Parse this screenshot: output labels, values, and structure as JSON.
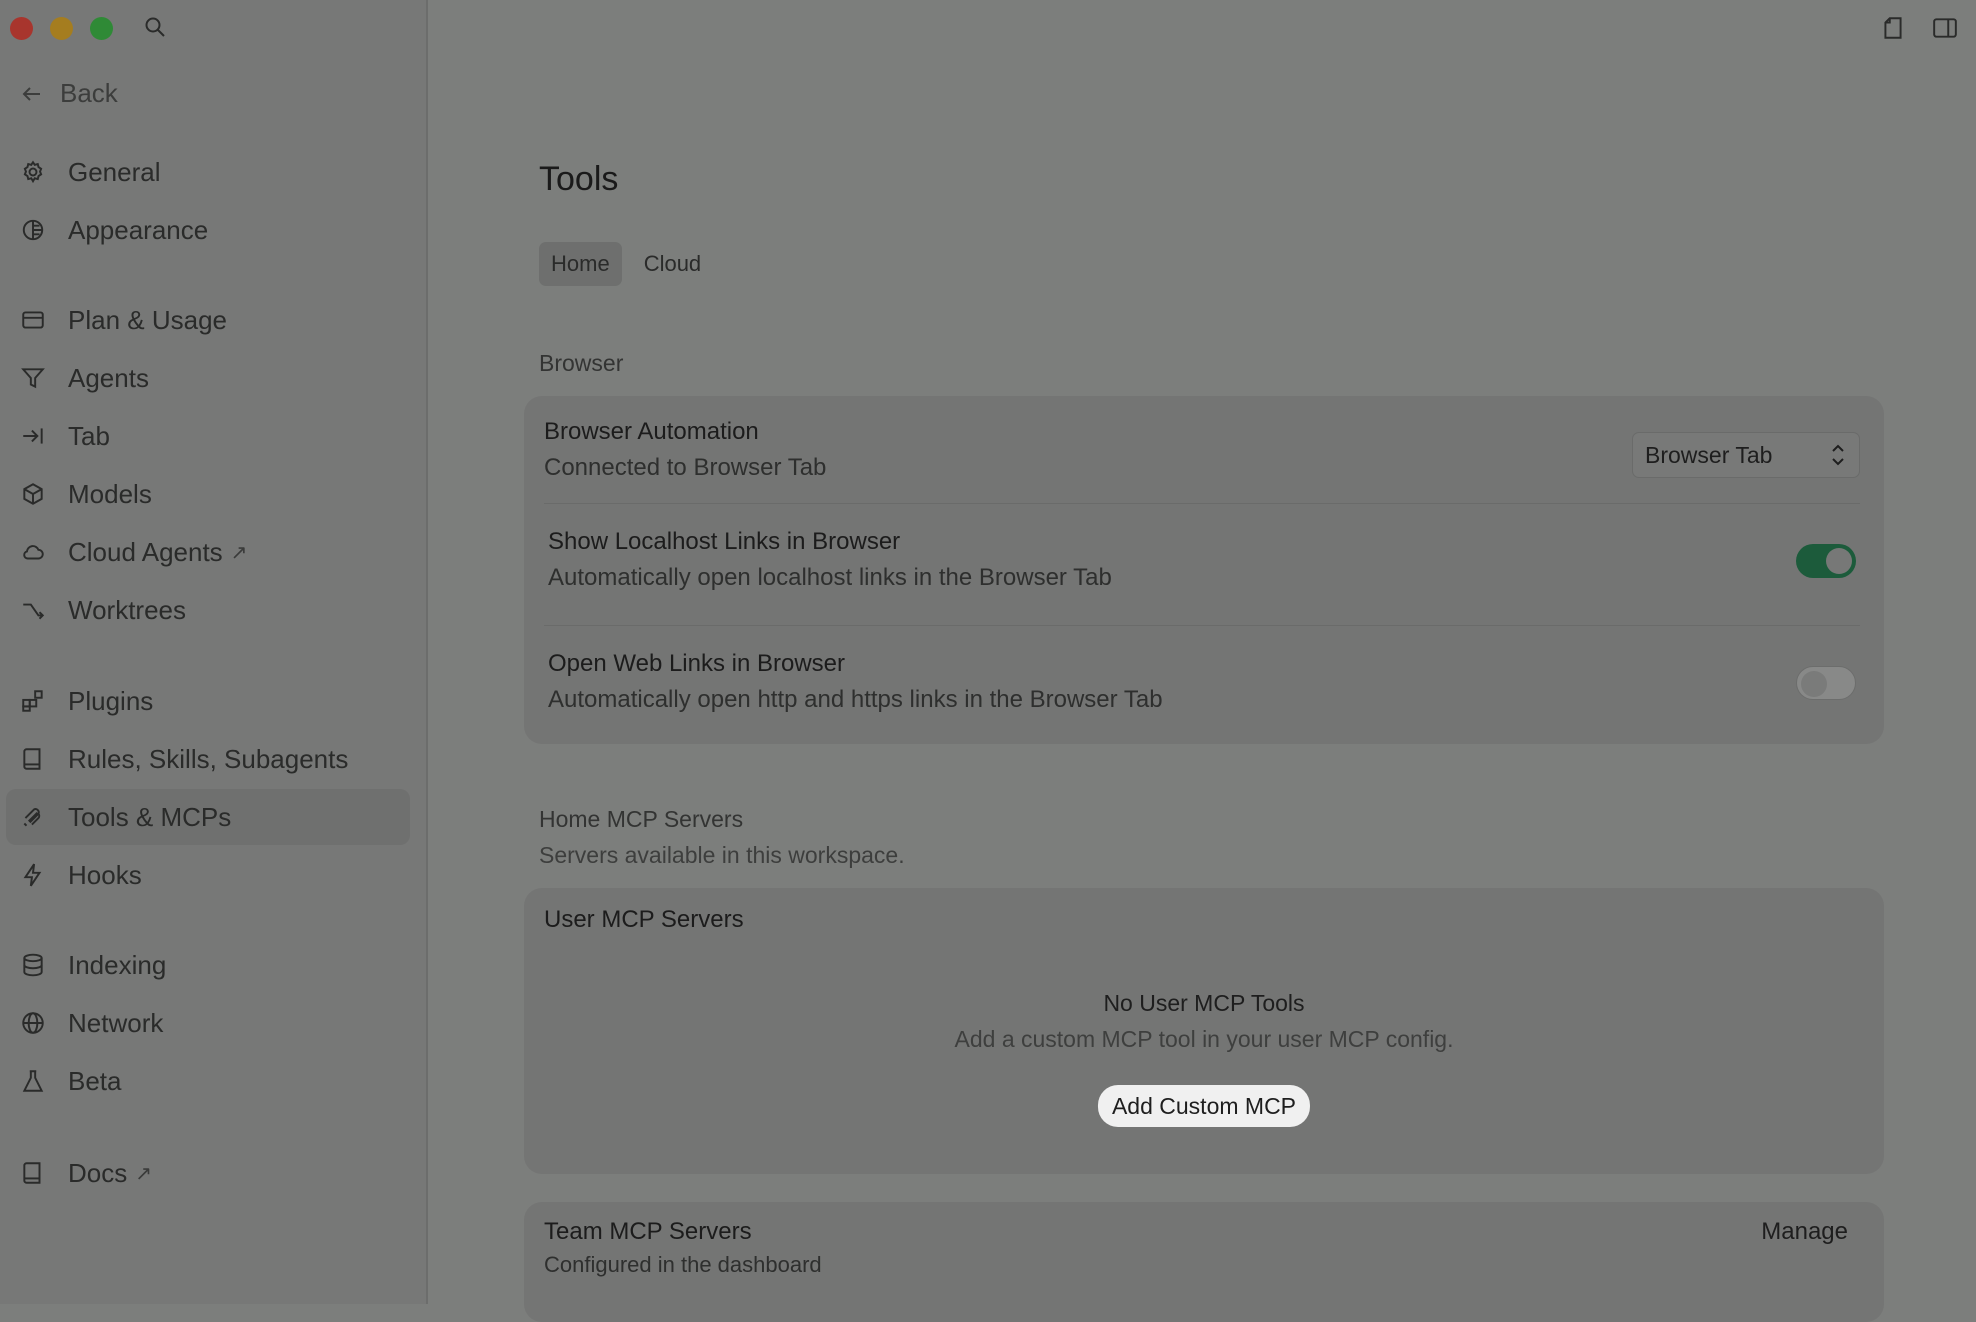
{
  "window": {
    "controls": [
      "close",
      "minimize",
      "zoom"
    ]
  },
  "sidebar": {
    "back_label": "Back",
    "items": [
      {
        "label": "General",
        "icon": "gear-icon"
      },
      {
        "label": "Appearance",
        "icon": "contrast-icon"
      },
      {
        "label": "Plan & Usage",
        "icon": "card-icon"
      },
      {
        "label": "Agents",
        "icon": "funnel-icon"
      },
      {
        "label": "Tab",
        "icon": "tab-arrow-icon"
      },
      {
        "label": "Models",
        "icon": "cube-icon"
      },
      {
        "label": "Cloud Agents",
        "icon": "cloud-icon",
        "external": "↗"
      },
      {
        "label": "Worktrees",
        "icon": "branch-icon"
      },
      {
        "label": "Plugins",
        "icon": "puzzle-icon"
      },
      {
        "label": "Rules, Skills, Subagents",
        "icon": "book-icon"
      },
      {
        "label": "Tools & MCPs",
        "icon": "tools-icon",
        "active": true
      },
      {
        "label": "Hooks",
        "icon": "bolt-icon"
      },
      {
        "label": "Indexing",
        "icon": "database-icon"
      },
      {
        "label": "Network",
        "icon": "globe-icon"
      },
      {
        "label": "Beta",
        "icon": "flask-icon"
      },
      {
        "label": "Docs",
        "icon": "book-icon",
        "external": "↗"
      }
    ]
  },
  "main": {
    "title": "Tools",
    "tabs": [
      {
        "label": "Home",
        "active": true
      },
      {
        "label": "Cloud",
        "active": false
      }
    ],
    "browser_section": {
      "label": "Browser",
      "automation": {
        "title": "Browser Automation",
        "subtitle": "Connected to Browser Tab",
        "select_value": "Browser Tab"
      },
      "localhost": {
        "title": "Show Localhost Links in Browser",
        "subtitle": "Automatically open localhost links in the Browser Tab",
        "enabled": true
      },
      "weblinks": {
        "title": "Open Web Links in Browser",
        "subtitle": "Automatically open http and https links in the Browser Tab",
        "enabled": false
      }
    },
    "mcp_section": {
      "label": "Home MCP Servers",
      "subtitle": "Servers available in this workspace.",
      "user": {
        "title": "User MCP Servers",
        "empty_title": "No User MCP Tools",
        "empty_sub": "Add a custom MCP tool in your user MCP config.",
        "add_button": "Add Custom MCP"
      },
      "team": {
        "title": "Team MCP Servers",
        "subtitle": "Configured in the dashboard",
        "manage_label": "Manage"
      }
    }
  },
  "colors": {
    "toggle_on": "#1c5b3b",
    "sidebar_bg": "#777877",
    "main_bg": "#7c7e7c"
  }
}
